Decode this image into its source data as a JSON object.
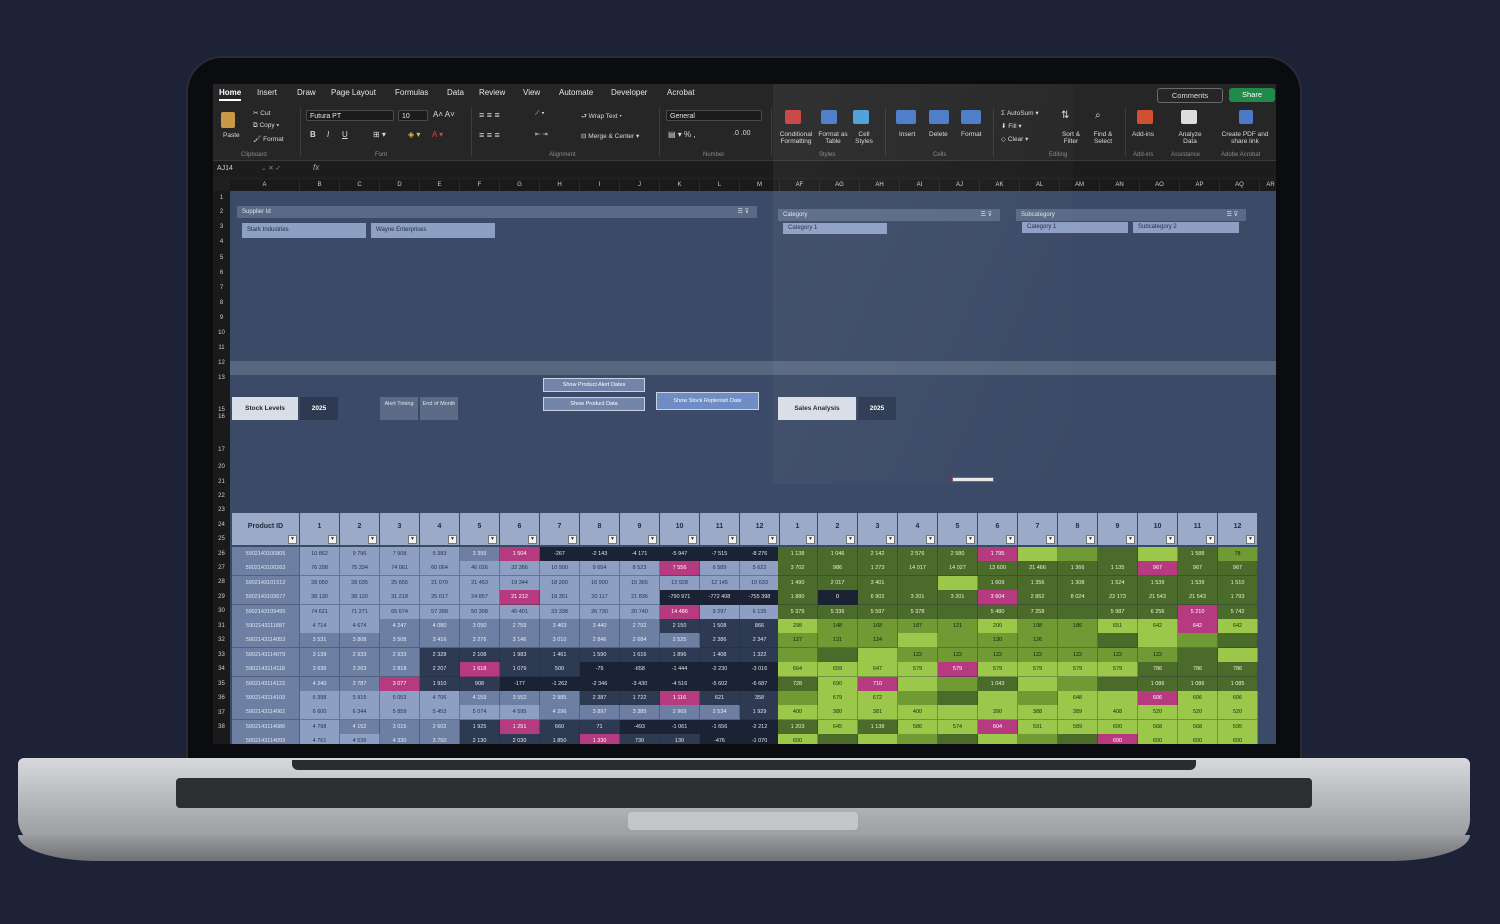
{
  "ribbon": {
    "tabs": [
      "Home",
      "Insert",
      "Draw",
      "Page Layout",
      "Formulas",
      "Data",
      "Review",
      "View",
      "Automate",
      "Developer",
      "Acrobat"
    ],
    "active_tab": "Home",
    "comments_label": "Comments",
    "share_label": "Share",
    "clipboard": {
      "paste": "Paste",
      "cut": "Cut",
      "copy": "Copy",
      "format": "Format",
      "group": "Clipboard"
    },
    "font": {
      "name": "Futura PT",
      "size": "10",
      "bold": "B",
      "italic": "I",
      "underline": "U",
      "group": "Font"
    },
    "alignment": {
      "wrap": "Wrap Text",
      "merge": "Merge & Center",
      "group": "Alignment"
    },
    "number": {
      "format": "General",
      "group": "Number"
    },
    "styles": {
      "conditional": "Conditional Formatting",
      "format_table": "Format as Table",
      "cell_styles": "Cell Styles",
      "group": "Styles"
    },
    "cells": {
      "insert": "Insert",
      "delete": "Delete",
      "format": "Format",
      "group": "Cells"
    },
    "editing": {
      "autosum": "AutoSum",
      "fill": "Fill",
      "clear": "Clear",
      "sort": "Sort & Filter",
      "find": "Find & Select",
      "group": "Editing"
    },
    "addins": {
      "label": "Add-ins",
      "group": "Add-ins"
    },
    "analyze": {
      "label": "Analyze Data",
      "group": "Assistance"
    },
    "acrobat": {
      "label": "Create PDF and share link",
      "group": "Adobe Acrobat"
    }
  },
  "formula_bar": {
    "name_box": "AJ14",
    "fx": "fx"
  },
  "columns": [
    "A",
    "B",
    "C",
    "D",
    "E",
    "F",
    "G",
    "H",
    "I",
    "J",
    "K",
    "L",
    "M",
    "AF",
    "AG",
    "AH",
    "AI",
    "AJ",
    "AK",
    "AL",
    "AM",
    "AN",
    "AO",
    "AP",
    "AQ",
    "AR"
  ],
  "rows": [
    "1",
    "2",
    "3",
    "4",
    "5",
    "6",
    "7",
    "8",
    "9",
    "10",
    "11",
    "12",
    "13",
    "15",
    "16",
    "17",
    "20",
    "21",
    "22",
    "23",
    "24",
    "25",
    "26",
    "27",
    "28",
    "29",
    "30",
    "31",
    "32",
    "33",
    "34",
    "35",
    "36",
    "37",
    "38"
  ],
  "slicers": {
    "supplier": {
      "title": "Supplier Id",
      "items": [
        "Stark Industries",
        "Wayne Enterprises"
      ]
    },
    "category": {
      "title": "Category",
      "items": [
        "Category 1"
      ]
    },
    "subcategory": {
      "title": "Subcategory",
      "items": [
        "Category 1",
        "Subcategory 2"
      ]
    }
  },
  "buttons": {
    "alert_dates": "Show Product Alert Dates",
    "product_data": "Show Product Data",
    "replenish": "Show Stock Replenish Date"
  },
  "stock_levels": {
    "label": "Stock Levels",
    "year": "2025",
    "alert_timing": "Alert Timing",
    "end_of_month": "End of Month"
  },
  "sales_analysis": {
    "label": "Sales Analysis",
    "year": "2025"
  },
  "table": {
    "product_header": "Product ID",
    "month_headers": [
      "1",
      "2",
      "3",
      "4",
      "5",
      "6",
      "7",
      "8",
      "9",
      "10",
      "11",
      "12"
    ],
    "product_ids": [
      "5902143100805",
      "5902143100263",
      "5902143101512",
      "5902143103677",
      "5902143109495",
      "5902143111887",
      "5902143114053",
      "5902143114079",
      "5902143114118",
      "5902143114122",
      "5902143114109",
      "5902143114062",
      "5902143114086",
      "5902143114093",
      "5902143114473",
      "5902143114499",
      "5902143114482",
      "5902143117469",
      "5902143118527"
    ],
    "stock": [
      [
        "10 862",
        "9 796",
        "7 908",
        "5 383",
        "3 399",
        "1 504",
        "-267",
        "-2 143",
        "-4 171",
        "-5 947",
        "-7 515",
        "-8 276"
      ],
      [
        "76 298",
        "75 334",
        "74 061",
        "60 064",
        "46 026",
        "32 386",
        "10 900",
        "9 654",
        "8 523",
        "7 556",
        "6 589",
        "5 622"
      ],
      [
        "28 050",
        "28 035",
        "25 655",
        "21 079",
        "21 453",
        "19 344",
        "18 200",
        "16 900",
        "15 365",
        "13 928",
        "12 145",
        "10 633"
      ],
      [
        "38 130",
        "38 120",
        "31 218",
        "25 017",
        "24 857",
        "21 212",
        "18 351",
        "20 117",
        "21 836",
        "-790 971",
        "-772 408",
        "-755 398"
      ],
      [
        "74 621",
        "71 271",
        "65 674",
        "57 398",
        "50 308",
        "40 401",
        "33 338",
        "26 730",
        "20 740",
        "14 486",
        "9 297",
        "6 135"
      ],
      [
        "4 714",
        "4 674",
        "4 247",
        "4 080",
        "3 090",
        "2 759",
        "3 463",
        "3 440",
        "2 792",
        "2 150",
        "1 508",
        "866"
      ],
      [
        "3 531",
        "3 808",
        "3 508",
        "3 416",
        "3 276",
        "3 146",
        "3 010",
        "2 846",
        "2 684",
        "2 525",
        "2 386",
        "2 347"
      ],
      [
        "3 139",
        "2 933",
        "2 933",
        "2 328",
        "2 108",
        "1 983",
        "1 461",
        "1 590",
        "1 616",
        "1 896",
        "1 408",
        "1 322"
      ],
      [
        "3 636",
        "3 263",
        "2 818",
        "2 207",
        "1 618",
        "1 079",
        "500",
        "-79",
        "-658",
        "-1 444",
        "-2 230",
        "-3 016"
      ],
      [
        "4 240",
        "3 787",
        "3 077",
        "1 910",
        "908",
        "-177",
        "-1 262",
        "-2 346",
        "-3 430",
        "-4 516",
        "-5 602",
        "-6 687"
      ],
      [
        "6 398",
        "5 915",
        "5 053",
        "4 706",
        "4 159",
        "3 552",
        "2 985",
        "2 387",
        "1 722",
        "1 116",
        "621",
        "358"
      ],
      [
        "6 600",
        "6 344",
        "5 859",
        "5 453",
        "5 074",
        "4 595",
        "4 296",
        "3 897",
        "3 385",
        "2 969",
        "2 534",
        "1 929"
      ],
      [
        "4 798",
        "4 152",
        "3 015",
        "2 602",
        "1 925",
        "1 251",
        "660",
        "71",
        "-493",
        "-1 061",
        "-1 656",
        "-2 212"
      ],
      [
        "4 761",
        "4 536",
        "4 330",
        "3 750",
        "2 130",
        "2 030",
        "1 850",
        "1 330",
        "730",
        "130",
        "-476",
        "-1 070"
      ],
      [
        "4 451",
        "4 437",
        "4 316",
        "4 126",
        "3 862",
        "3 866",
        "3 687",
        "3 443",
        "3 226",
        "3 175",
        "3 125",
        "2 877"
      ],
      [
        "3 941",
        "3 923",
        "3 869",
        "3 848",
        "3 796",
        "3 761",
        "3 724",
        "3 676",
        "3 616",
        "3 564",
        "3 518",
        "3 497"
      ],
      [
        "3 952",
        "3 935",
        "3 861",
        "3 550",
        "3 498",
        "3 458",
        "3 348",
        "3 416",
        "3 398",
        "3 300",
        "3 266",
        "3 219"
      ],
      [
        "3 688",
        "3 437",
        "2 908",
        "2 201",
        "1 757",
        "1 032",
        "412",
        "-301",
        "-947",
        "-1 381",
        "-1 794",
        "-2 028"
      ],
      [
        "3 803",
        "3 771",
        "3 606",
        "3 548",
        "3 389",
        "3 199",
        "3 002",
        "2 862",
        "2 724",
        "2 588",
        "2 426",
        "2 264"
      ]
    ],
    "sales": [
      [
        "1 138",
        "1 046",
        "2 142",
        "2 576",
        "2 580",
        "1 795",
        "",
        "",
        "",
        "",
        "1 588",
        "78"
      ],
      [
        "3 702",
        "986",
        "1 273",
        "14 017",
        "14 027",
        "13 600",
        "21 466",
        "1 366",
        "1 135",
        "967",
        "967",
        "967"
      ],
      [
        "1 490",
        "2 017",
        "3 401",
        "",
        "",
        "1 609",
        "1 356",
        "1 308",
        "1 524",
        "1 539",
        "1 539",
        "1 510"
      ],
      [
        "1 880",
        "0",
        "6 902",
        "3 201",
        "3 201",
        "3 604",
        "2 862",
        "8 024",
        "22 173",
        "21 543",
        "21 543",
        "1 793"
      ],
      [
        "5 379",
        "5 336",
        "5 597",
        "5 378",
        "",
        "5 480",
        "7 258",
        "",
        "5 987",
        "6 256",
        "5 210",
        "5 742"
      ],
      [
        "298",
        "148",
        "168",
        "187",
        "121",
        "200",
        "198",
        "186",
        "651",
        "642",
        "642",
        "642"
      ],
      [
        "127",
        "131",
        "124",
        "",
        "",
        "130",
        "126",
        "",
        "",
        "",
        "",
        ""
      ],
      [
        "",
        "",
        "",
        "122",
        "122",
        "122",
        "122",
        "122",
        "122",
        "122",
        "",
        ""
      ],
      [
        "664",
        "659",
        "647",
        "579",
        "579",
        "579",
        "579",
        "579",
        "579",
        "786",
        "786",
        "786"
      ],
      [
        "728",
        "690",
        "710",
        "",
        "",
        "1 043",
        "",
        "",
        "",
        "1 086",
        "1 086",
        "1 085"
      ],
      [
        "",
        "679",
        "672",
        "",
        "",
        "",
        "",
        "648",
        "",
        "606",
        "606",
        "606"
      ],
      [
        "400",
        "380",
        "381",
        "400",
        "",
        "390",
        "388",
        "389",
        "408",
        "520",
        "520",
        "520"
      ],
      [
        "1 203",
        "645",
        "1 138",
        "586",
        "574",
        "604",
        "591",
        "589",
        "600",
        "568",
        "568",
        "595"
      ],
      [
        "600",
        "",
        "",
        "",
        "",
        "",
        "",
        "",
        "600",
        "600",
        "600",
        "600"
      ],
      [
        "240",
        "174",
        "167",
        "147",
        "",
        "",
        "170",
        "",
        "",
        "150",
        "150",
        "147"
      ],
      [
        "59",
        "",
        "",
        "",
        "",
        "",
        "37",
        "",
        "60",
        "",
        "",
        ""
      ],
      [
        "45",
        "",
        "",
        "",
        "",
        "",
        "",
        "",
        "",
        "",
        "",
        ""
      ],
      [
        "817",
        "",
        "",
        "",
        "634",
        "",
        "",
        "723",
        "",
        "435",
        "413",
        ""
      ],
      [
        "135",
        "",
        "",
        "",
        "",
        "",
        "",
        "",
        "",
        "",
        "",
        ""
      ]
    ]
  },
  "colors": {
    "screen_bg": "#3b4a66",
    "green_dark": "#4b6b2a",
    "green_mid": "#6f9a34",
    "green_light": "#9bc84a",
    "blue_light": "#8da0c4",
    "blue_mid": "#6d7fa2",
    "navy": "#2d3a52",
    "magenta": "#b63a7f"
  }
}
